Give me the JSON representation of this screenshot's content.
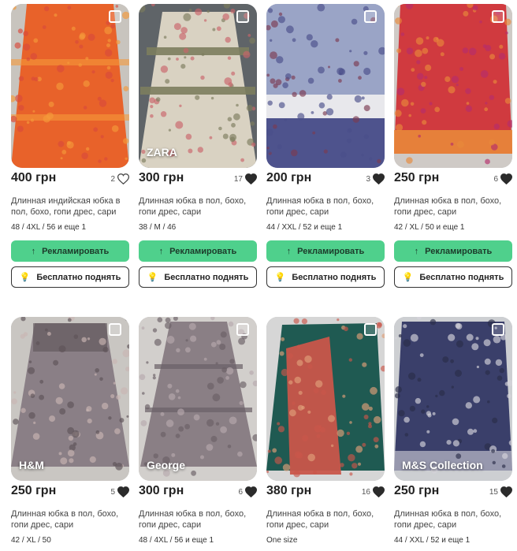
{
  "listings": [
    {
      "price": "400 грн",
      "likes": "2",
      "liked": false,
      "title": "Длинная индийская юбка в пол, бохо, гопи дрес, сари",
      "sizes": "48 / 4XL / 56 и еще 1",
      "brand": "",
      "promote": "Рекламировать",
      "raise": "Бесплатно поднять",
      "colors": [
        "#e8622a",
        "#f59a3a",
        "#d94a3c"
      ]
    },
    {
      "price": "300 грн",
      "likes": "17",
      "liked": true,
      "title": "Длинная юбка в пол, бохо, гопи дрес, сари",
      "sizes": "38 / M / 46",
      "brand": "ZARA",
      "promote": "Рекламировать",
      "raise": "Бесплатно поднять",
      "colors": [
        "#d9d2c2",
        "#7c7d5e",
        "#c9646a"
      ]
    },
    {
      "price": "200 грн",
      "likes": "3",
      "liked": true,
      "title": "Длинная юбка в пол, бохо, гопи дрес, сари",
      "sizes": "44 / XXL / 52 и еще 1",
      "brand": "",
      "promote": "Рекламировать",
      "raise": "Бесплатно поднять",
      "colors": [
        "#9aa4c6",
        "#4a4f8a",
        "#7b3a52"
      ]
    },
    {
      "price": "250 грн",
      "likes": "6",
      "liked": true,
      "title": "Длинная юбка в пол, бохо, гопи дрес, сари",
      "sizes": "42 / XL / 50 и еще 1",
      "brand": "",
      "promote": "Рекламировать",
      "raise": "Бесплатно поднять",
      "colors": [
        "#d03a3f",
        "#e8883a",
        "#b52d6b"
      ]
    },
    {
      "price": "250 грн",
      "likes": "5",
      "liked": true,
      "title": "Длинная юбка в пол, бохо, гопи дрес, сари",
      "sizes": "42 / XL / 50",
      "brand": "H&M",
      "colors": [
        "#8a7f86",
        "#5d5358",
        "#c9b5b2"
      ]
    },
    {
      "price": "300 грн",
      "likes": "6",
      "liked": true,
      "title": "Длинная юбка в пол, бохо, гопи дрес, сари",
      "sizes": "48 / 4XL / 56 и еще 1",
      "brand": "George",
      "colors": [
        "#8a7f85",
        "#6a5f66",
        "#b7a9ad"
      ]
    },
    {
      "price": "380 грн",
      "likes": "16",
      "liked": true,
      "title": "Длинная юбка в пол, бохо, гопи дрес, сари",
      "sizes": "One size",
      "brand": "",
      "colors": [
        "#1f5a52",
        "#c9564a",
        "#e0a07a"
      ]
    },
    {
      "price": "250 грн",
      "likes": "15",
      "liked": true,
      "title": "Длинная юбка в пол, бохо, гопи дрес, сари",
      "sizes": "44 / XXL / 52 и еще 1",
      "brand": "M&S Collection",
      "colors": [
        "#3a3f6a",
        "#d6d4dc",
        "#2a2d48"
      ]
    }
  ]
}
